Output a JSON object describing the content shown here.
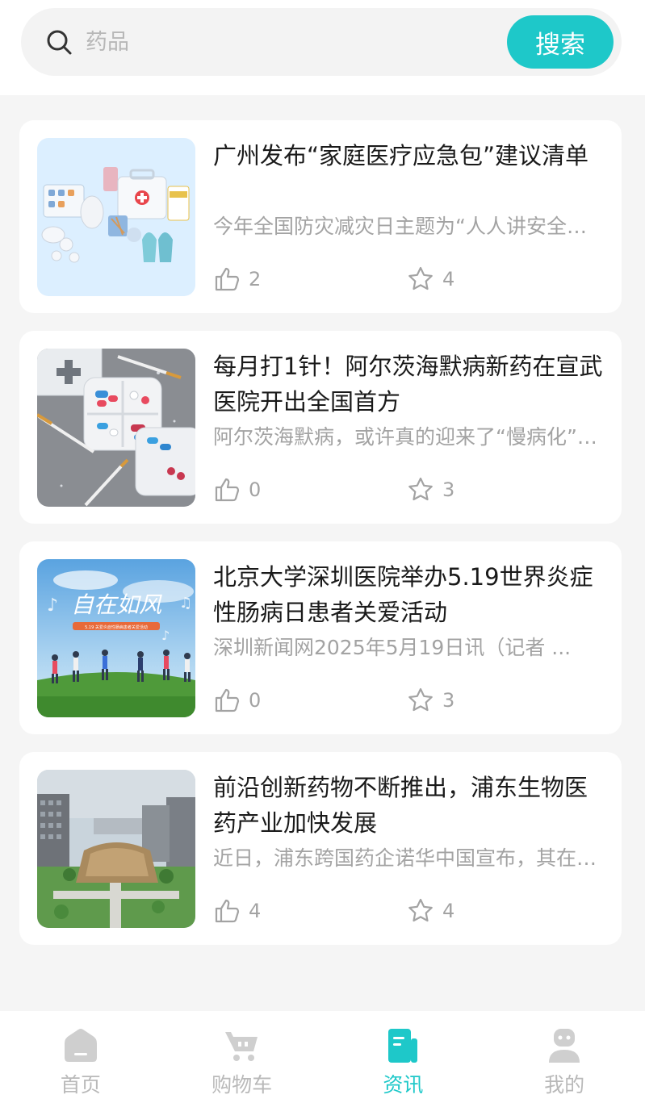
{
  "search": {
    "placeholder": "药品",
    "button_label": "搜索"
  },
  "colors": {
    "accent": "#1ec8c9",
    "muted_text": "#a3a3a3",
    "inactive_tab": "#b9b9b9"
  },
  "articles": [
    {
      "title": "广州发布“家庭医疗应急包”建议清单",
      "summary": "今年全国防灾减灾日主题为“人人讲安全、个个会应急”",
      "likes": "2",
      "favorites": "4",
      "image": "medical-kit-illustration"
    },
    {
      "title": "每月打1针！阿尔茨海默病新药在宣武医院开出全国首方",
      "summary": "阿尔茨海默病，或许真的迎来了“慢病化”时代",
      "likes": "0",
      "favorites": "3",
      "image": "pill-boxes-and-syringes"
    },
    {
      "title": "北京大学深圳医院举办5.19世界炎症性肠病日患者关爱活动",
      "summary": "深圳新闻网2025年5月19日讯（记者 ...",
      "likes": "0",
      "favorites": "3",
      "image": "running-people-poster",
      "image_text": "自在如风",
      "image_subtext": "5.19 关爱炎症性肠病患者关爱活动"
    },
    {
      "title": "前沿创新药物不断推出，浦东生物医药产业加快发展",
      "summary": "近日，浦东跨国药企诺华中国宣布，其在中国的研发",
      "likes": "4",
      "favorites": "4",
      "image": "campus-aerial-photo"
    }
  ],
  "tabbar": {
    "items": [
      {
        "label": "首页",
        "icon": "home-icon",
        "active": false
      },
      {
        "label": "购物车",
        "icon": "cart-icon",
        "active": false
      },
      {
        "label": "资讯",
        "icon": "news-icon",
        "active": true
      },
      {
        "label": "我的",
        "icon": "profile-icon",
        "active": false
      }
    ]
  }
}
